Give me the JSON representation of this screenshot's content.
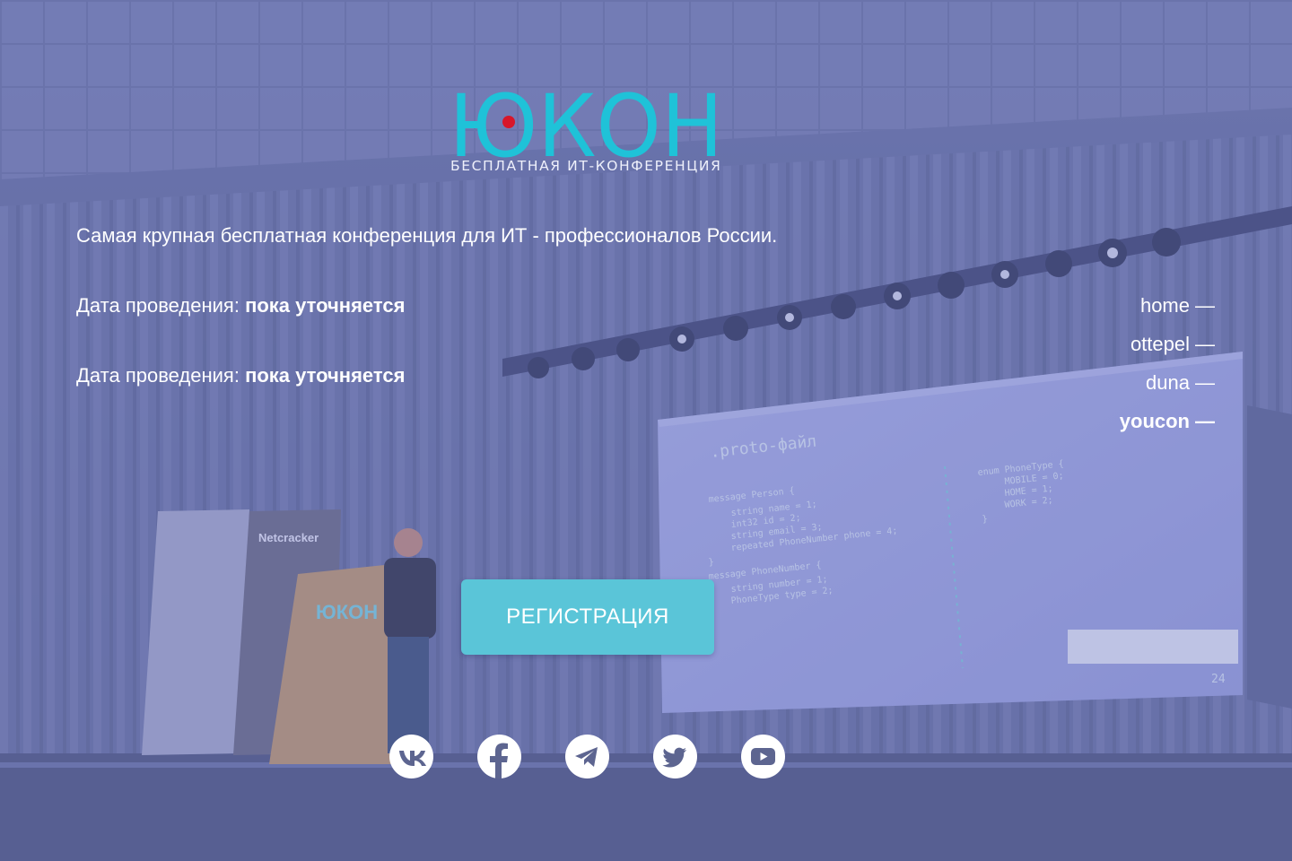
{
  "logo": {
    "wordmark": "ЮКОН",
    "subtitle": "БЕСПЛАТНАЯ ИТ-КОНФЕРЕНЦИЯ",
    "color": "#1fc2d8",
    "dot_color": "#d8162a"
  },
  "hero": {
    "tagline": "Самая крупная бесплатная конференция для ИТ - профессионалов России.",
    "date_rows": [
      {
        "label": "Дата проведения: ",
        "value": "пока уточняется"
      },
      {
        "label": "Дата проведения: ",
        "value": "пока уточняется"
      }
    ]
  },
  "nav": {
    "items": [
      {
        "label": "home",
        "active": false
      },
      {
        "label": "ottepel",
        "active": false
      },
      {
        "label": "duna",
        "active": false
      },
      {
        "label": "youcon",
        "active": true
      }
    ],
    "dash": "—"
  },
  "register_button": {
    "label": "РЕГИСТРАЦИЯ",
    "color": "#5ac5d8"
  },
  "socials": [
    {
      "name": "vk",
      "icon": "vk-icon"
    },
    {
      "name": "facebook",
      "icon": "facebook-icon"
    },
    {
      "name": "telegram",
      "icon": "telegram-icon"
    },
    {
      "name": "twitter",
      "icon": "twitter-icon"
    },
    {
      "name": "youtube",
      "icon": "youtube-icon"
    }
  ],
  "background": {
    "overlay_color": "#6a74b4",
    "slide": {
      "title": ".proto-файл",
      "code_left": [
        "message Person {",
        "string name = 1;",
        "int32 id = 2;",
        "string email = 3;",
        "repeated PhoneNumber phone = 4;",
        "}",
        "message PhoneNumber {",
        "string number = 1;",
        "PhoneType type = 2;",
        "}"
      ],
      "code_right": [
        "enum PhoneType {",
        "MOBILE = 0;",
        "HOME = 1;",
        "WORK = 2;",
        "}"
      ],
      "page_number": "24"
    },
    "banner_sponsor": "Netcracker",
    "podium_logo": "ЮКОН"
  }
}
